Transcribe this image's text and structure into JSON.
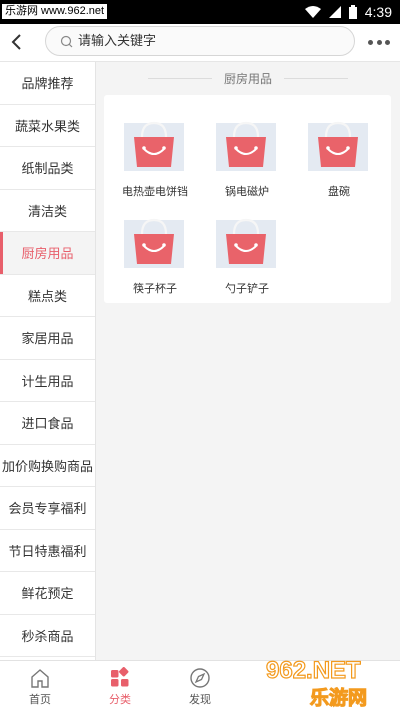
{
  "status_bar": {
    "watermark": "乐游网 www.962.net",
    "time": "4:39",
    "icons": [
      "wifi-icon",
      "signal-icon",
      "battery-icon"
    ]
  },
  "header": {
    "search_placeholder": "请输入关键字",
    "back_icon": "chevron-left-icon",
    "search_icon": "search-icon",
    "more_icon": "more-dots-icon"
  },
  "sidebar": {
    "active_index": 4,
    "items": [
      {
        "label": "品牌推荐"
      },
      {
        "label": "蔬菜水果类"
      },
      {
        "label": "纸制品类"
      },
      {
        "label": "清洁类"
      },
      {
        "label": "厨房用品"
      },
      {
        "label": "糕点类"
      },
      {
        "label": "家居用品"
      },
      {
        "label": "计生用品"
      },
      {
        "label": "进口食品"
      },
      {
        "label": "加价购换购商品"
      },
      {
        "label": "会员专享福利"
      },
      {
        "label": "节日特惠福利"
      },
      {
        "label": "鲜花预定"
      },
      {
        "label": "秒杀商品"
      }
    ]
  },
  "main": {
    "section_title": "厨房用品",
    "products": [
      {
        "name": "电热壶电饼铛",
        "icon": "shopping-bag-icon"
      },
      {
        "name": "锅电磁炉",
        "icon": "shopping-bag-icon"
      },
      {
        "name": "盘碗",
        "icon": "shopping-bag-icon"
      },
      {
        "name": "筷子杯子",
        "icon": "shopping-bag-icon"
      },
      {
        "name": "勺子铲子",
        "icon": "shopping-bag-icon"
      }
    ]
  },
  "bottom_nav": {
    "active_index": 1,
    "items": [
      {
        "label": "首页",
        "icon": "home-icon"
      },
      {
        "label": "分类",
        "icon": "category-icon"
      },
      {
        "label": "发现",
        "icon": "compass-icon"
      }
    ]
  },
  "logo_watermark": {
    "text_top": "962.NET",
    "text_bottom": "乐游网"
  },
  "colors": {
    "accent": "#e85f6b",
    "bag": "#e9636a"
  }
}
